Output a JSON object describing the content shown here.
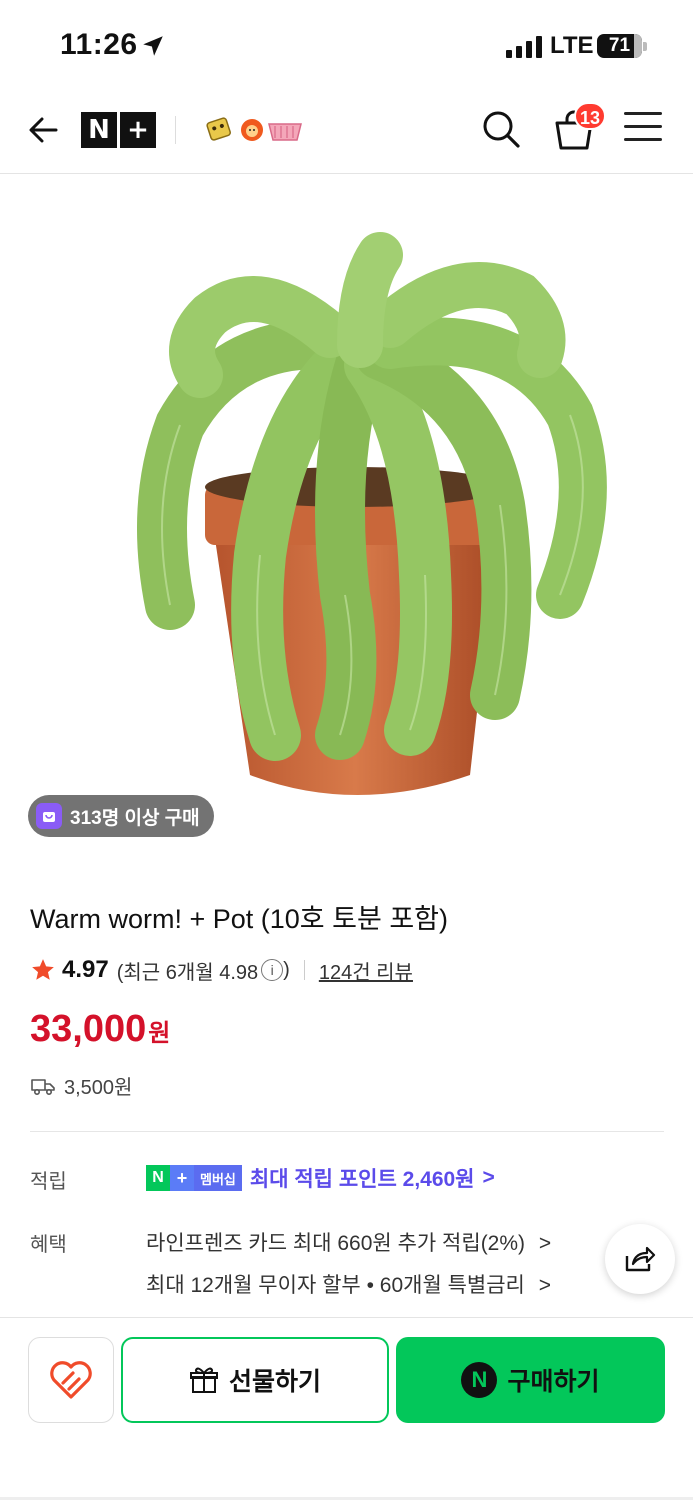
{
  "status_bar": {
    "time": "11:26",
    "network": "LTE",
    "battery": "71"
  },
  "header": {
    "brand_n": "N",
    "brand_plus": "+",
    "cart_count": "13",
    "icons": [
      "back-arrow-icon",
      "search-icon",
      "cart-icon",
      "menu-icon"
    ]
  },
  "product": {
    "buyers_badge": "313명 이상 구매",
    "title": "Warm worm! + Pot (10호 토분 포함)",
    "rating": "4.97",
    "recent_rating": "(최근 6개월 4.98",
    "recent_rating_close": ")",
    "info_glyph": "i",
    "review_count": "124건 리뷰",
    "price": "33,000",
    "price_unit": "원",
    "shipping_fee": "3,500원"
  },
  "benefits": {
    "points_label": "적립",
    "membership_n": "N",
    "membership_plus": "+",
    "membership_badge": "멤버십",
    "points_text": "최대 적립 포인트 2,460원",
    "benefit_label": "혜택",
    "benefit_1": "라인프렌즈 카드 최대 660원 추가 적립(2%)",
    "benefit_2": "최대 12개월 무이자 할부 • 60개월 특별금리",
    "chevron": ">"
  },
  "bottom_bar": {
    "gift_label": "선물하기",
    "buy_label": "구매하기",
    "npay_glyph": "N"
  },
  "colors": {
    "price_red": "#d4112a",
    "naver_green": "#03c75a",
    "membership_purple": "#5b4bea",
    "badge_red": "#ff3b30"
  }
}
